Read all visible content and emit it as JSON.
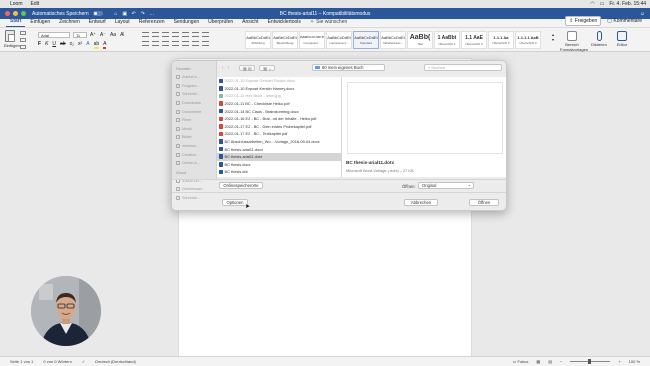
{
  "menubar": {
    "items": [
      "Loom",
      "Edit"
    ],
    "datetime": "Fr. 4. Feb.  15:44"
  },
  "titlebar": {
    "autosave": "Automatisches Speichern",
    "title": "BC thesis-arial11 – Kompatibilitätsmodus"
  },
  "ribbon_tabs": {
    "tabs": [
      "Start",
      "Einfügen",
      "Zeichnen",
      "Entwurf",
      "Layout",
      "Referenzen",
      "Sendungen",
      "Überprüfen",
      "Ansicht",
      "Entwicklertools"
    ],
    "search": "Sie wünschen",
    "share": "Freigeben",
    "comments": "Kommentare"
  },
  "ribbon": {
    "paste": "Einfügen",
    "font": "Arial",
    "size": "11",
    "styles": [
      {
        "sample": "AaBbCcDdEt",
        "name": "Abbildung"
      },
      {
        "sample": "AaBbCcDdEt",
        "name": "Beschriftung"
      },
      {
        "sample": "AaBbCcDdEe",
        "name": "Computerc..."
      },
      {
        "sample": "AaBbCcDdEt",
        "name": "Literaturverz..."
      },
      {
        "sample": "AaBbCcDdEt",
        "name": "Standard"
      },
      {
        "sample": "AaBbCcDdEt",
        "name": "Tabellenbesc..."
      },
      {
        "sample": "AaBb(",
        "name": "Titel"
      },
      {
        "sample": "1 AaBbt",
        "name": "Überschrift 1"
      },
      {
        "sample": "1.1 AaE",
        "name": "Überschrift 2"
      },
      {
        "sample": "1.1.1 Aa",
        "name": "Überschrift 3"
      },
      {
        "sample": "1.1.1.1 AaB",
        "name": "Überschrift 4"
      }
    ],
    "styles_pane": "Bereich Formatvorlagen",
    "dictate": "Diktieren",
    "editor": "Editor"
  },
  "dialog": {
    "sidebar": {
      "favorites_header": "Favoriten",
      "favorites": [
        "Zuletzt b...",
        "Program...",
        "Schreibti...",
        "Downloads",
        "Dokumente",
        "Filme",
        "Musik",
        "Bilder",
        "helsinno...",
        "Creative...",
        "Online-A..."
      ],
      "icloud_header": "iCloud",
      "icloud": [
        "iCloud Dri...",
        "Gemeinsam",
        "Schreibti..."
      ]
    },
    "location": "60 mein eigenes Buch",
    "search_placeholder": "Suchen",
    "files": [
      {
        "name": "2022-01-10 Exposé Gerhart Flooke.docx",
        "kind": "word",
        "fade": true
      },
      {
        "name": "2022-01-10 Exposé Kerstin Harney.docx",
        "kind": "word",
        "fade": false
      },
      {
        "name": "2022-01-12 Hex Buch - arbel.jpg",
        "kind": "img",
        "fade": true
      },
      {
        "name": "2022-01-11 BC - Checkliste Heiko.pdf",
        "kind": "pdf",
        "fade": false
      },
      {
        "name": "2022-01-14 BC Claus - Brainstorming.docx",
        "kind": "word",
        "fade": false
      },
      {
        "name": "2022-01-16 E2 - BC - Brai...nd der Inhalte - Heiko.pdf",
        "kind": "pdf",
        "fade": false
      },
      {
        "name": "2022-01-17 E2 - BC - Dein erstes Probekapitel.pdf",
        "kind": "pdf",
        "fade": false
      },
      {
        "name": "2022-01-17 E2 - BC - Textkapitel.pdf",
        "kind": "pdf",
        "fade": false
      },
      {
        "name": "BC Abschlussarbeiten_Wo...-Vorlage_2016-09-04.docx",
        "kind": "word",
        "fade": false
      },
      {
        "name": "BC thesis-arial11.docx",
        "kind": "word",
        "fade": false
      },
      {
        "name": "BC thesis-arial11.dotx",
        "kind": "word",
        "fade": false,
        "selected": true
      },
      {
        "name": "BC thesis.docx",
        "kind": "word",
        "fade": false
      },
      {
        "name": "BC thesis.dot",
        "kind": "word",
        "fade": false
      },
      {
        "name": "BC thesis.dotx",
        "kind": "word",
        "fade": false
      }
    ],
    "preview": {
      "name": "BC thesis-arial11.dotx",
      "meta": "Microsoft Word-Vorlage (.dotx) – 27 KB"
    },
    "online_locations": "Onlinespeicherorte",
    "open_label": "Öffnen:",
    "open_mode": "Original",
    "options": "Optionen",
    "cancel": "Abbrechen",
    "open": "Öffnen"
  },
  "statusbar": {
    "page": "Seite 1 von 1",
    "words": "0 von 0 Wörtern",
    "language": "Deutsch (Deutschland)",
    "focus": "Fokus",
    "zoom": "100 %"
  },
  "colors": {
    "word_blue": "#2b579a",
    "selection": "#d5d5d5",
    "pdf_red": "#d9463b",
    "folder_blue": "#5aa0e6"
  }
}
